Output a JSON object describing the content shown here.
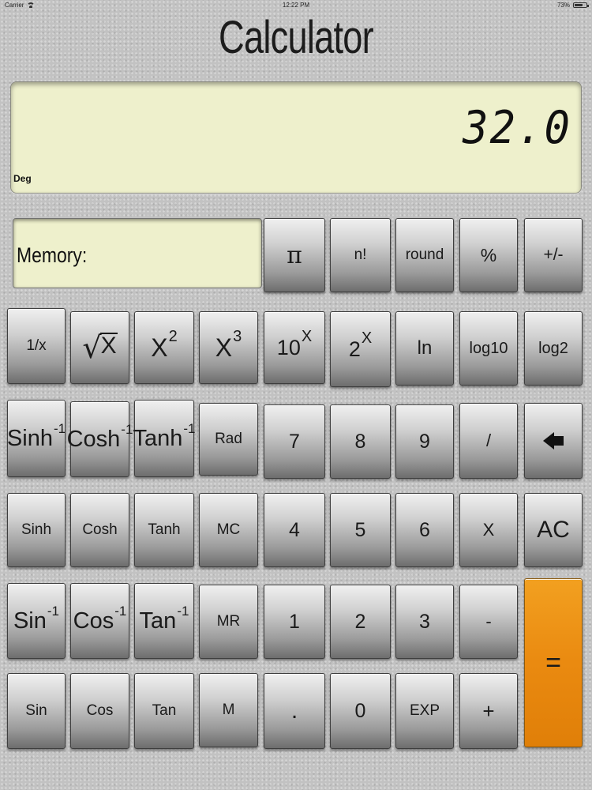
{
  "status_bar": {
    "carrier": "Carrier",
    "time": "12:22 PM",
    "battery": "73%",
    "battery_level": 0.73
  },
  "app_title": "Calculator",
  "display": {
    "value": "32.0",
    "mode": "Deg"
  },
  "memory": {
    "label": "Memory:"
  },
  "keys": {
    "pi": "π",
    "factorial": "n!",
    "round": "round",
    "percent": "%",
    "plus_minus": "+/-",
    "reciprocal": "1/x",
    "sqrt_base": "X",
    "x_squared_base": "X",
    "x_squared_exp": "2",
    "x_cubed_base": "X",
    "x_cubed_exp": "3",
    "ten_pow_base": "10",
    "ten_pow_exp": "X",
    "two_pow_base": "2",
    "two_pow_exp": "X",
    "ln": "ln",
    "log10": "log10",
    "log2": "log2",
    "asinh_base": "Sinh",
    "asinh_exp": "-1",
    "acosh_base": "Cosh",
    "acosh_exp": "-1",
    "atanh_base": "Tanh",
    "atanh_exp": "-1",
    "rad": "Rad",
    "seven": "7",
    "eight": "8",
    "nine": "9",
    "divide": "/",
    "sinh": "Sinh",
    "cosh": "Cosh",
    "tanh": "Tanh",
    "mc": "MC",
    "four": "4",
    "five": "5",
    "six": "6",
    "multiply": "X",
    "ac": "AC",
    "asin_base": "Sin",
    "asin_exp": "-1",
    "acos_base": "Cos",
    "acos_exp": "-1",
    "atan_base": "Tan",
    "atan_exp": "-1",
    "mr": "MR",
    "one": "1",
    "two": "2",
    "three": "3",
    "minus": "-",
    "equals": "=",
    "sin": "Sin",
    "cos": "Cos",
    "tan": "Tan",
    "m": "M",
    "decimal": ".",
    "zero": "0",
    "exp": "EXP",
    "plus": "+"
  },
  "icons": {
    "backspace": "backspace-arrow-icon",
    "wifi": "wifi-icon",
    "battery": "battery-icon"
  },
  "colors": {
    "display_bg": "#eef0cc",
    "equals_key": "#ea8a10",
    "background": "#c2c2c2"
  }
}
